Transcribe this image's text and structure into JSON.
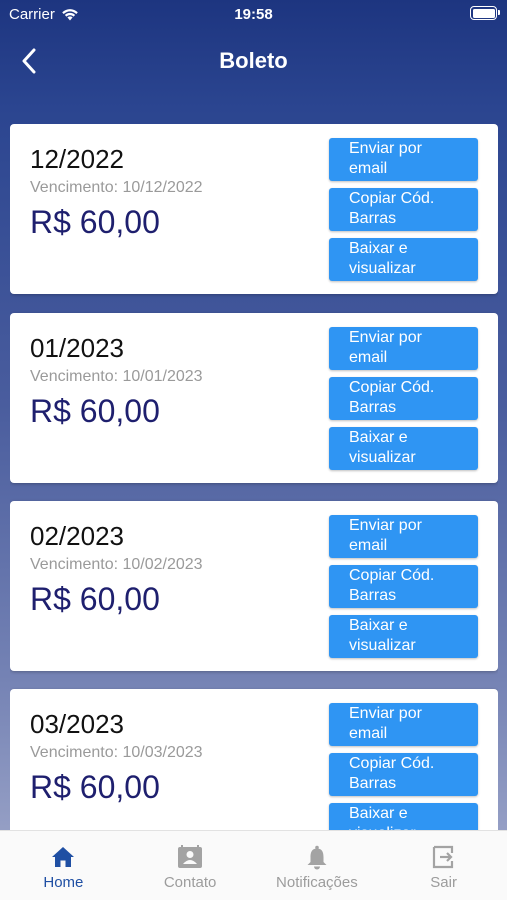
{
  "status": {
    "carrier": "Carrier",
    "time": "19:58"
  },
  "header": {
    "title": "Boleto"
  },
  "boletos": [
    {
      "period": "12/2022",
      "due": "Vencimento: 10/12/2022",
      "amount": "R$ 60,00"
    },
    {
      "period": "01/2023",
      "due": "Vencimento: 10/01/2023",
      "amount": "R$ 60,00"
    },
    {
      "period": "02/2023",
      "due": "Vencimento: 10/02/2023",
      "amount": "R$ 60,00"
    },
    {
      "period": "03/2023",
      "due": "Vencimento: 10/03/2023",
      "amount": "R$ 60,00"
    }
  ],
  "actions": {
    "email": [
      "Enviar por",
      "email"
    ],
    "barcode": [
      "Copiar Cód.",
      "Barras"
    ],
    "download": [
      "Baixar e",
      "visualizar"
    ]
  },
  "tabs": [
    {
      "label": "Home",
      "icon": "home-icon"
    },
    {
      "label": "Contato",
      "icon": "contact-card-icon"
    },
    {
      "label": "Notificações",
      "icon": "bell-icon"
    },
    {
      "label": "Sair",
      "icon": "logout-icon"
    }
  ],
  "colors": {
    "accent": "#2f95f3",
    "amount": "#1e1f6e",
    "tab_active": "#1f4fa3",
    "tab_inactive": "#9c9c9c"
  }
}
